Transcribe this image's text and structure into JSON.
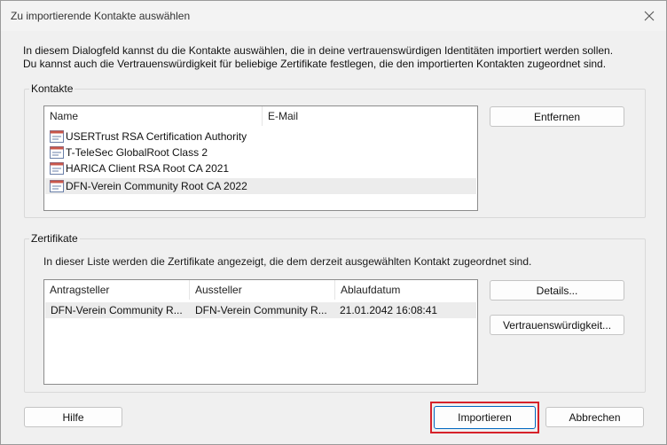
{
  "dialog": {
    "title": "Zu importierende Kontakte auswählen",
    "intro_line1": "In diesem Dialogfeld kannst du die Kontakte auswählen, die in deine vertrauenswürdigen Identitäten importiert werden sollen.",
    "intro_line2": "Du kannst auch die Vertrauenswürdigkeit für beliebige Zertifikate festlegen, die den importierten Kontakten zugeordnet sind."
  },
  "contacts": {
    "label": "Kontakte",
    "columns": [
      "Name",
      "E-Mail"
    ],
    "rows": [
      {
        "name": "USERTrust RSA Certification Authority",
        "email": "",
        "icon": "certificate-icon"
      },
      {
        "name": "T-TeleSec GlobalRoot Class 2",
        "email": "",
        "icon": "certificate-icon"
      },
      {
        "name": "HARICA Client RSA Root CA 2021",
        "email": "",
        "icon": "certificate-icon"
      },
      {
        "name": "DFN-Verein Community Root CA 2022",
        "email": "",
        "icon": "certificate-icon",
        "selected": true
      }
    ],
    "remove_button": "Entfernen"
  },
  "certificates": {
    "label": "Zertifikate",
    "description": "In dieser Liste werden die Zertifikate angezeigt, die dem derzeit ausgewählten Kontakt zugeordnet sind.",
    "columns": [
      "Antragsteller",
      "Aussteller",
      "Ablaufdatum"
    ],
    "rows": [
      {
        "subject": "DFN-Verein Community R...",
        "issuer": "DFN-Verein Community R...",
        "expires": "21.01.2042 16:08:41"
      }
    ],
    "details_button": "Details...",
    "trust_button": "Vertrauenswürdigkeit..."
  },
  "footer": {
    "help_button": "Hilfe",
    "import_button": "Importieren",
    "cancel_button": "Abbrechen"
  },
  "colors": {
    "accent": "#0067c0",
    "highlight": "#d6222a",
    "selection": "#ececec"
  }
}
